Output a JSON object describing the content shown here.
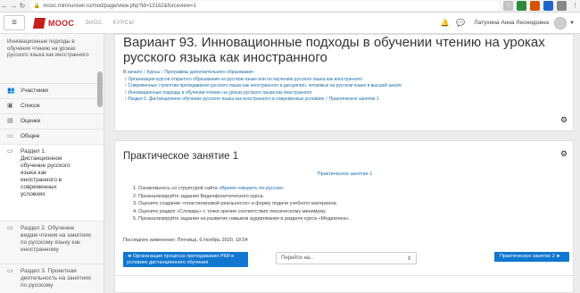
{
  "browser": {
    "url": "mooc.mininuniver.ru/mod/page/view.php?id=13162&forceview=1",
    "back": "←",
    "forward": "→",
    "reload": "↻"
  },
  "navbar": {
    "logo": "MOOC",
    "links": [
      "ЭИОС",
      "КУРСЫ"
    ],
    "user_name": "Латухина Анна Леонидовна"
  },
  "sidebar": {
    "course_name": "Инновационные подходы в обучении чтению на уроках русского языка как иностранного",
    "items": [
      {
        "label": "Участники",
        "icon": "users-icon"
      },
      {
        "label": "Список",
        "icon": "list-icon"
      },
      {
        "label": "Оценки",
        "icon": "grades-icon"
      },
      {
        "label": "Общее",
        "icon": "folder-icon"
      },
      {
        "label": "Раздел 1. Дистанционное обучение русского языка как иностранного в современных условиях",
        "icon": "folder-icon"
      },
      {
        "label": "Раздел 2. Обучение видам чтения на занятиях по русскому языку как иностранному",
        "icon": "folder-icon"
      },
      {
        "label": "Раздел 3. Проектная деятельность на занятиях по русскому",
        "icon": "folder-icon"
      }
    ]
  },
  "header": {
    "title": "Вариант 93. Инновационные подходы в обучении чтению на уроках русского языка как иностранного",
    "breadcrumb_top": [
      "В начало",
      "Курсы",
      "Программы дополнительного образования"
    ],
    "breadcrumb_lines": [
      "Организация курсов открытого образования на русском языке или по изучению русского языка как иностранного",
      "Современные стратегии преподавания русского языка как иностранного и дисциплин, читаемых на русском языке в высшей школе",
      "Инновационные подходы в обучении чтению на уроках русского языка как иностранного",
      "Раздел 1. Дистанционное обучение русского языка как иностранного в современных условиях",
      "Практическое занятие 1"
    ],
    "separator": "/"
  },
  "content": {
    "title": "Практическое занятие 1",
    "center_link": "Практическое занятие 1",
    "list": [
      {
        "prefix": "1. Ознакомьтесь со структурой сайта «",
        "link": "Время говорить по-русски",
        "suffix": "»"
      },
      {
        "prefix": "2. Проанализируйте задания Видеофонетического курса.",
        "link": "",
        "suffix": ""
      },
      {
        "prefix": "3. Оцените создание «пластилиновой реальности» и форму подачи учебного материала.",
        "link": "",
        "suffix": ""
      },
      {
        "prefix": "4. Оцените раздел «Словарь» с точки зрения соответствия лексическому минимуму.",
        "link": "",
        "suffix": ""
      },
      {
        "prefix": "5. Проанализируйте задания на развитие навыков аудирования в разделе курса «Медиатека».",
        "link": "",
        "suffix": ""
      }
    ],
    "modified": "Последнее изменение: Пятница, 6 Ноябрь 2020, 18:54",
    "prev_label": "◄ Организация процесса преподавания РКИ в условиях дистанционного обучения",
    "jump_placeholder": "Перейти на...",
    "next_label": "Практическое занятие 2 ►"
  }
}
